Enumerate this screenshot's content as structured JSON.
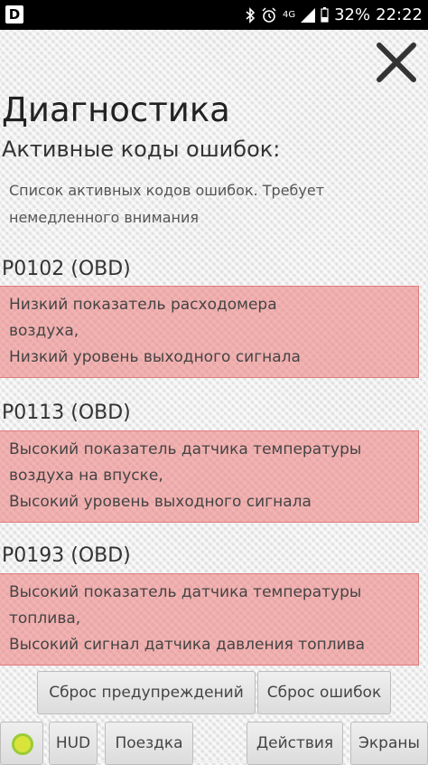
{
  "status_bar": {
    "app_badge": "D",
    "network": "4G",
    "battery": "32%",
    "time": "22:22"
  },
  "header": {
    "title": "Диагностика",
    "subtitle": "Активные коды ошибок:",
    "description": "Список активных кодов ошибок. Требует немедленного внимания"
  },
  "errors": [
    {
      "code": "P0102 (OBD)",
      "lines": [
        "Низкий показатель расходомера",
        "воздуха,",
        "Низкий уровень выходного сигнала"
      ]
    },
    {
      "code": "P0113 (OBD)",
      "lines": [
        "Высокий показатель датчика температуры",
        "воздуха на впуске,",
        "Высокий уровень выходного сигнала"
      ]
    },
    {
      "code": "P0193 (OBD)",
      "lines": [
        "Высокий показатель датчика температуры",
        "топлива,",
        "Высокий сигнал датчика давления топлива"
      ]
    }
  ],
  "actions": {
    "reset_warnings": "Сброс предупреждений",
    "reset_errors": "Сброс ошибок"
  },
  "bottom_nav": {
    "hud": "HUD",
    "trip": "Поездка",
    "actions": "Действия",
    "screens": "Экраны"
  },
  "colors": {
    "error_background": "#ee7878",
    "status_indicator": "#d9e43a"
  }
}
